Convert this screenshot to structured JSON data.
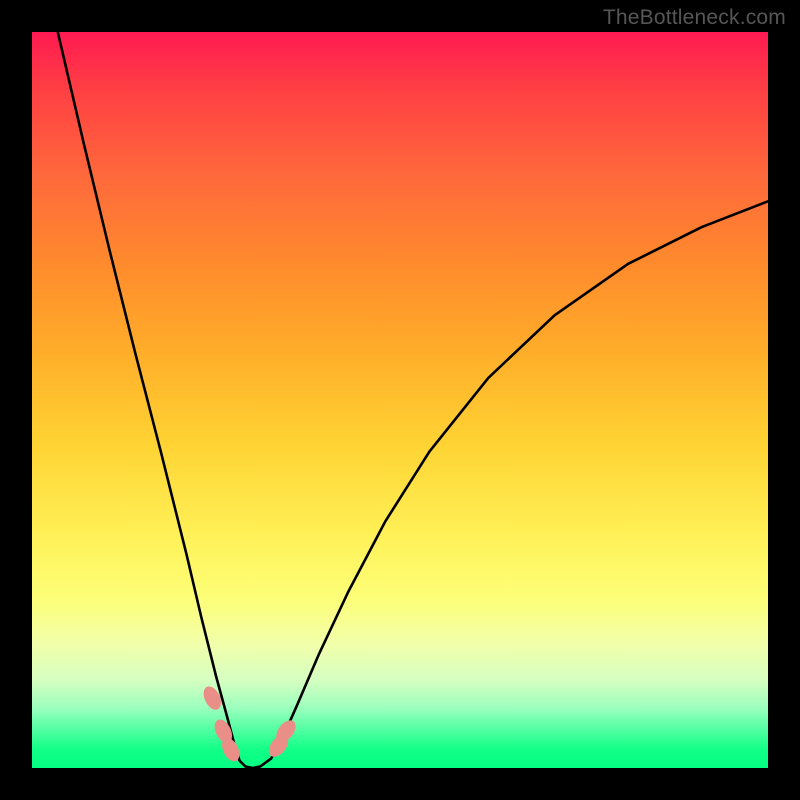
{
  "watermark": "TheBottleneck.com",
  "chart_data": {
    "type": "line",
    "title": "",
    "xlabel": "",
    "ylabel": "",
    "xlim": [
      0,
      100
    ],
    "ylim": [
      0,
      100
    ],
    "series": [
      {
        "name": "bottleneck-curve",
        "x": [
          3.5,
          7.0,
          10.5,
          14.0,
          17.5,
          21.0,
          23.0,
          25.0,
          26.5,
          27.5,
          28.2,
          29.0,
          30.0,
          31.0,
          32.5,
          34.0,
          36.0,
          39.0,
          43.0,
          48.0,
          54.0,
          62.0,
          71.0,
          81.0,
          91.0,
          100.0
        ],
        "y": [
          100.0,
          85.0,
          70.5,
          56.5,
          43.0,
          29.0,
          20.5,
          12.5,
          7.0,
          3.2,
          1.0,
          0.2,
          0.0,
          0.2,
          1.3,
          4.0,
          8.5,
          15.5,
          24.0,
          33.5,
          43.0,
          53.0,
          61.5,
          68.5,
          73.5,
          77.0
        ]
      }
    ],
    "markers": [
      {
        "name": "left-marker-1",
        "x": 24.5,
        "y": 9.5
      },
      {
        "name": "left-marker-2",
        "x": 26.0,
        "y": 5.0
      },
      {
        "name": "left-marker-3",
        "x": 27.0,
        "y": 2.5
      },
      {
        "name": "right-marker-1",
        "x": 33.5,
        "y": 3.0
      },
      {
        "name": "right-marker-2",
        "x": 34.5,
        "y": 5.0
      }
    ],
    "gradient_stops": [
      {
        "offset": 0.0,
        "color": "#ff1a52"
      },
      {
        "offset": 0.5,
        "color": "#ffd333"
      },
      {
        "offset": 0.85,
        "color": "#fdff78"
      },
      {
        "offset": 1.0,
        "color": "#04ff82"
      }
    ]
  }
}
